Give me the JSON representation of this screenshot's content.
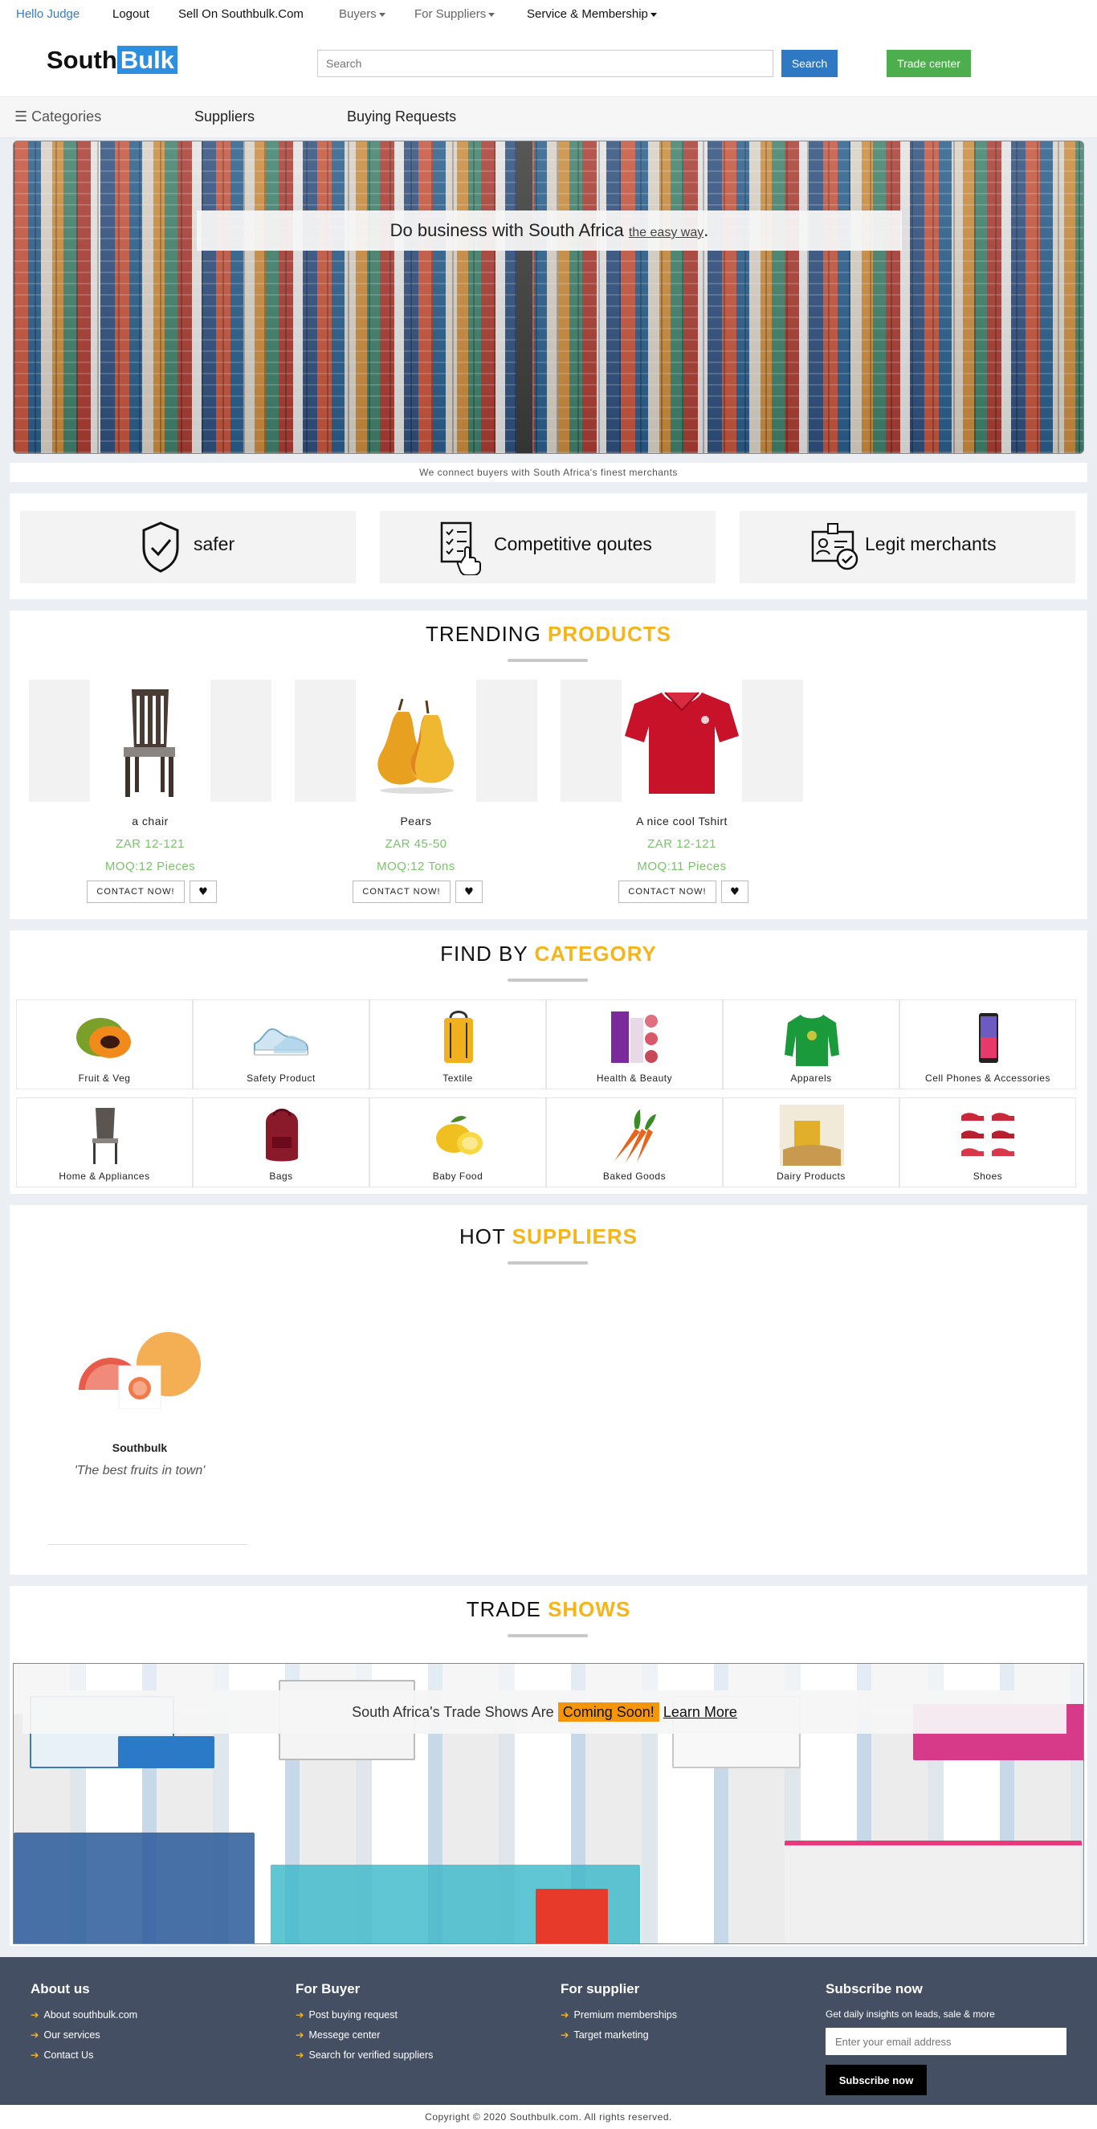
{
  "topbar": {
    "hello": "Hello Judge",
    "logout": "Logout",
    "sell": "Sell On Southbulk.Com",
    "buyers": "Buyers",
    "suppliers": "For Suppliers",
    "service": "Service & Membership"
  },
  "header": {
    "logo_south": "South",
    "logo_bulk": "Bulk",
    "search_placeholder": "Search",
    "search_button": "Search",
    "trade_button": "Trade center"
  },
  "nav": {
    "categories": "Categories",
    "suppliers": "Suppliers",
    "buying_requests": "Buying Requests"
  },
  "hero": {
    "title": "Do business with South Africa",
    "title_link": "the easy way",
    "title_end": ".",
    "tagline": "We connect buyers with South Africa's finest merchants"
  },
  "features": [
    {
      "label": "safer",
      "icon": "shield-check-icon"
    },
    {
      "label": "Competitive qoutes",
      "icon": "checklist-icon"
    },
    {
      "label": "Legit merchants",
      "icon": "id-card-icon"
    }
  ],
  "trending": {
    "title_plain": "TRENDING",
    "title_hl": "PRODUCTS",
    "products": [
      {
        "name": "a chair",
        "price": "ZAR 12-121",
        "moq": "MOQ:12 Pieces",
        "contact": "CONTACT NOW!",
        "icon": "chair-icon"
      },
      {
        "name": "Pears",
        "price": "ZAR 45-50",
        "moq": "MOQ:12 Tons",
        "contact": "CONTACT NOW!",
        "icon": "pear-icon"
      },
      {
        "name": "A nice cool Tshirt",
        "price": "ZAR 12-121",
        "moq": "MOQ:11 Pieces",
        "contact": "CONTACT NOW!",
        "icon": "tshirt-icon"
      }
    ]
  },
  "category": {
    "title_plain": "FIND BY",
    "title_hl": "CATEGORY",
    "items": [
      {
        "label": "Fruit & Veg",
        "icon": "papaya-icon"
      },
      {
        "label": "Safety Product",
        "icon": "sneaker-icon"
      },
      {
        "label": "Textile",
        "icon": "backpack-icon"
      },
      {
        "label": "Health & Beauty",
        "icon": "cosmetics-icon"
      },
      {
        "label": "Apparels",
        "icon": "sweater-icon"
      },
      {
        "label": "Cell Phones & Accessories",
        "icon": "phone-icon"
      },
      {
        "label": "Home & Appliances",
        "icon": "chair-icon"
      },
      {
        "label": "Bags",
        "icon": "bag-icon"
      },
      {
        "label": "Baby Food",
        "icon": "lemon-icon"
      },
      {
        "label": "Baked Goods",
        "icon": "carrot-icon"
      },
      {
        "label": "Dairy Products",
        "icon": "honey-icon"
      },
      {
        "label": "Shoes",
        "icon": "shoes-icon"
      }
    ]
  },
  "hot_suppliers": {
    "title_plain": "HOT",
    "title_hl": "SUPPLIERS",
    "suppliers": [
      {
        "name": "Southbulk",
        "quote": "'The best fruits in town'"
      }
    ]
  },
  "trade_shows": {
    "title_plain": "TRADE",
    "title_hl": "SHOWS",
    "banner_text": "South Africa's Trade Shows Are",
    "badge": "Coming Soon!",
    "learn_more": "Learn More"
  },
  "footer": {
    "about": {
      "title": "About us",
      "links": [
        "About southbulk.com",
        "Our services",
        "Contact Us"
      ]
    },
    "buyer": {
      "title": "For Buyer",
      "links": [
        "Post buying request",
        "Messege center",
        "Search for verified suppliers"
      ]
    },
    "supplier": {
      "title": "For supplier",
      "links": [
        "Premium memberships",
        "Target marketing"
      ]
    },
    "subscribe": {
      "title": "Subscribe now",
      "desc": "Get daily insights on leads, sale & more",
      "placeholder": "Enter your email address",
      "button": "Subscribe now"
    },
    "copyright": "Copyright © 2020 Southbulk.com. All rights reserved."
  },
  "colors": {
    "accent": "#f5b518",
    "brand_blue": "#2c8fe0",
    "green": "#4cae4c",
    "price_green": "#79c46a",
    "footer_bg": "#454f63"
  }
}
